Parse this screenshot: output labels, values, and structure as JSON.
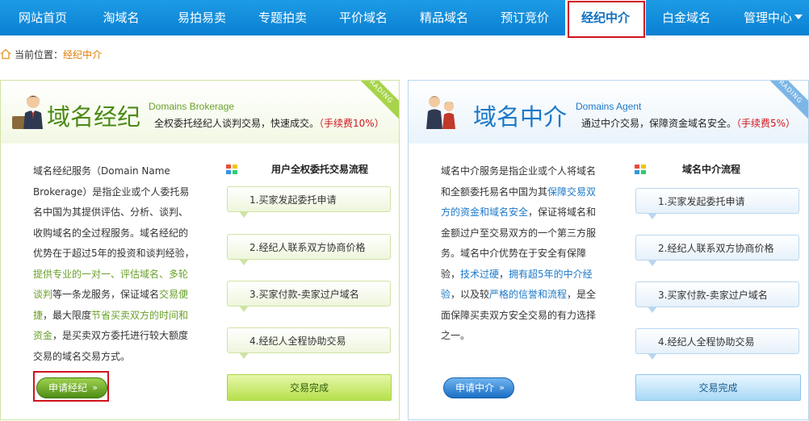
{
  "nav": {
    "items": [
      "网站首页",
      "淘域名",
      "易拍易卖",
      "专题拍卖",
      "平价域名",
      "精品域名",
      "预订竞价",
      "经纪中介",
      "白金域名"
    ],
    "active_index": 7,
    "last": "管理中心"
  },
  "breadcrumb": {
    "label": "当前位置：",
    "current": "经纪中介"
  },
  "brokerage": {
    "ribbon": "TRADING",
    "title": "域名经纪",
    "subtitle": "Domains Brokerage",
    "desc": "全权委托经纪人谈判交易，快速成交。",
    "fee": "（手续费10%）",
    "body": {
      "p1": "域名经纪服务（Domain Name Brokerage）是指企业或个人委托易名中国为其提供评估、分析、谈判、收购域名的全过程服务。域名经纪的优势在于超过5年的投资和谈判经验，",
      "h1": "提供专业的一对一、评估域名、多轮谈判",
      "p2": "等一条龙服务，保证域名",
      "h2": "交易便捷",
      "p3": "，最大限度",
      "h3": "节省买卖双方的时间和资金",
      "p4": "，是买卖双方委托进行较大额度交易的域名交易方式。"
    },
    "flow_title": "用户全权委托交易流程",
    "steps": [
      "1.买家发起委托申请",
      "2.经纪人联系双方协商价格",
      "3.买家付款-卖家过户域名",
      "4.经纪人全程协助交易"
    ],
    "done": "交易完成",
    "apply": "申请经纪",
    "apply_arrow": "»"
  },
  "agent": {
    "ribbon": "TRADING",
    "title": "域名中介",
    "subtitle": "Domains Agent",
    "desc": "通过中介交易，保障资金域名安全。",
    "fee": "（手续费5%）",
    "body": {
      "p1": "域名中介服务是指企业或个人将域名和全额委托易名中国为其",
      "h1": "保障交易双方的资金和域名安全",
      "p2": "，保证将域名和金额过户至交易双方的一个第三方服务。域名中介优势在于安全有保障验，",
      "h2": "技术过硬",
      "p3": "，",
      "h3": "拥有超5年的中介经验",
      "p4": "，以及较",
      "h4": "严格的信誉和流程",
      "p5": "，是全面保障买卖双方安全交易的有力选择之一。"
    },
    "flow_title": "域名中介流程",
    "steps": [
      "1.买家发起委托申请",
      "2.经纪人联系双方协商价格",
      "3.买家付款-卖家过户域名",
      "4.经纪人全程协助交易"
    ],
    "done": "交易完成",
    "apply": "申请中介",
    "apply_arrow": "»"
  },
  "colors": {
    "nav_bg": "#0a80d3",
    "green": "#6aa12a",
    "blue": "#1c78c8",
    "red_highlight": "#d0141d",
    "crumb_current": "#e27b00"
  }
}
